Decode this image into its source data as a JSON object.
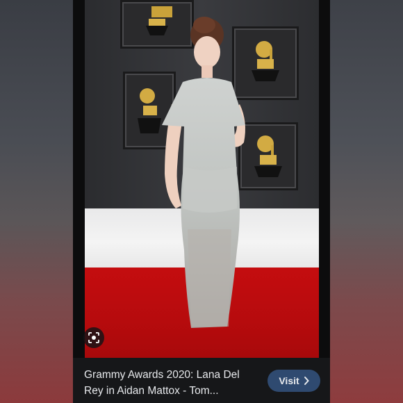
{
  "result": {
    "title": "Grammy Awards 2020: Lana Del Rey in Aidan Mattox - Tom...",
    "visit_label": "Visit",
    "visit_icon": "chevron-right-icon",
    "lens_icon": "image-search-icon"
  },
  "colors": {
    "carpet": "#c40d0f",
    "wall": "#2f3033",
    "caption_bg": "#161719",
    "visit_bg": "#2f4a70"
  }
}
